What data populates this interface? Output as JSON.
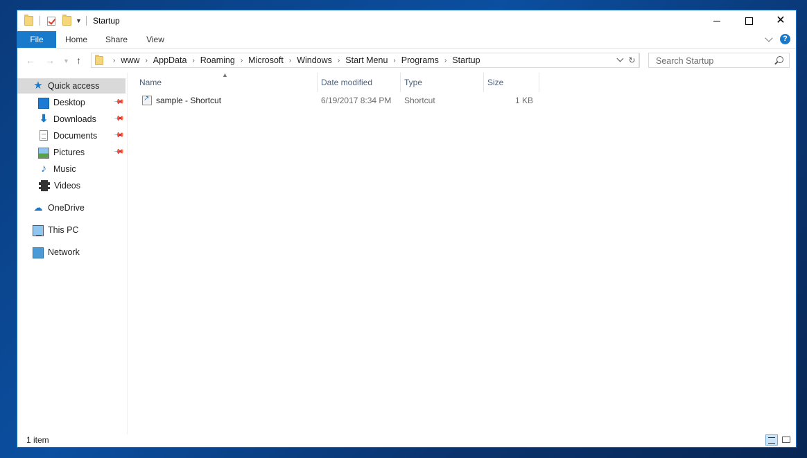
{
  "window": {
    "title": "Startup"
  },
  "ribbon": {
    "tabs": [
      "File",
      "Home",
      "Share",
      "View"
    ]
  },
  "address": {
    "crumbs": [
      "www",
      "AppData",
      "Roaming",
      "Microsoft",
      "Windows",
      "Start Menu",
      "Programs",
      "Startup"
    ]
  },
  "search": {
    "placeholder": "Search Startup"
  },
  "sidebar": {
    "items": [
      {
        "label": "Quick access",
        "icon": "star-icon",
        "selected": true
      },
      {
        "label": "Desktop",
        "icon": "desktop-icon",
        "pinned": true
      },
      {
        "label": "Downloads",
        "icon": "download-icon",
        "pinned": true
      },
      {
        "label": "Documents",
        "icon": "document-icon",
        "pinned": true
      },
      {
        "label": "Pictures",
        "icon": "picture-icon",
        "pinned": true
      },
      {
        "label": "Music",
        "icon": "music-icon"
      },
      {
        "label": "Videos",
        "icon": "video-icon"
      },
      {
        "label": "OneDrive",
        "icon": "cloud-icon"
      },
      {
        "label": "This PC",
        "icon": "computer-icon"
      },
      {
        "label": "Network",
        "icon": "network-icon"
      }
    ]
  },
  "columns": {
    "name": "Name",
    "date": "Date modified",
    "type": "Type",
    "size": "Size"
  },
  "files": [
    {
      "name": "sample - Shortcut",
      "date": "6/19/2017 8:34 PM",
      "type": "Shortcut",
      "size": "1 KB"
    }
  ],
  "status": {
    "count": "1 item"
  }
}
